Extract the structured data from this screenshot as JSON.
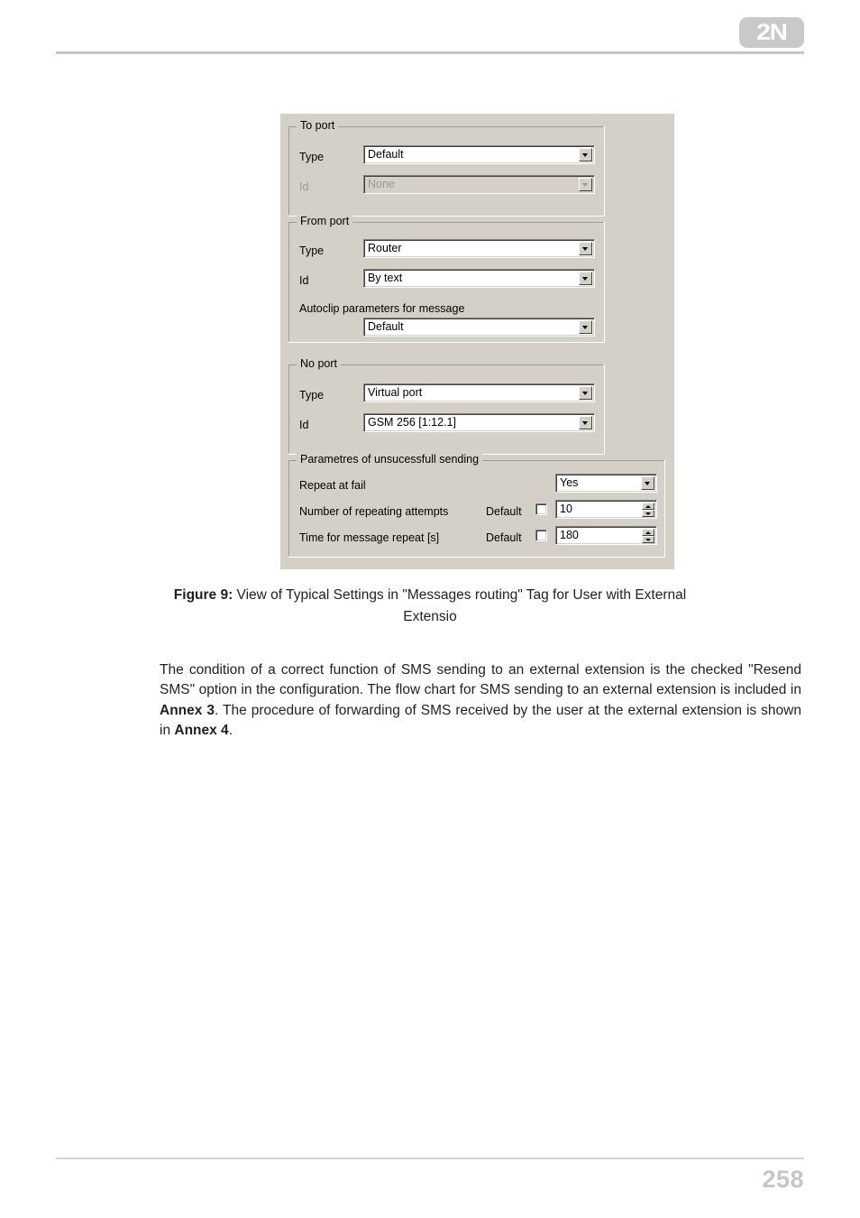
{
  "header": {
    "logo_text": "2N"
  },
  "dialog": {
    "groups": [
      {
        "title": "To port",
        "rows": [
          {
            "label": "Type",
            "value": "Default",
            "control": "combo",
            "disabled": false
          },
          {
            "label": "Id",
            "value": "None",
            "control": "combo",
            "disabled": true
          }
        ]
      },
      {
        "title": "From port",
        "rows": [
          {
            "label": "Type",
            "value": "Router",
            "control": "combo",
            "disabled": false
          },
          {
            "label": "Id",
            "value": "By text",
            "control": "combo",
            "disabled": false
          }
        ],
        "subcaption": "Autoclip parameters for message",
        "subvalue": "Default"
      },
      {
        "title": "No port",
        "rows": [
          {
            "label": "Type",
            "value": "Virtual port",
            "control": "combo",
            "disabled": false
          },
          {
            "label": "Id",
            "value": "GSM 256 [1:12.1]",
            "control": "combo",
            "disabled": false
          }
        ]
      },
      {
        "title": "Parametres of unsucessfull sending",
        "rows": [
          {
            "label": "Repeat at fail",
            "value": "Yes",
            "control": "combo",
            "disabled": false
          },
          {
            "label": "Number of repeating attempts",
            "default_label": "Default",
            "value": "10",
            "control": "spin",
            "checked": false
          },
          {
            "label": "Time for message repeat [s]",
            "default_label": "Default",
            "value": "180",
            "control": "spin",
            "checked": false
          }
        ]
      }
    ]
  },
  "caption": {
    "prefix": "Figure 9:",
    "text": " View of Typical Settings in \"Messages routing\" Tag for User with External Extensio"
  },
  "body": {
    "part1": "The condition of a correct function of SMS sending to an external extension is the checked \"Resend SMS\" option in the configuration. The flow chart for SMS sending to an external extension is included in ",
    "ref1": "Annex 3",
    "part2": ". The procedure of forwarding of SMS received by the user at the external extension is shown in ",
    "ref2": "Annex 4",
    "part3": "."
  },
  "footer": {
    "page_number": "258"
  }
}
